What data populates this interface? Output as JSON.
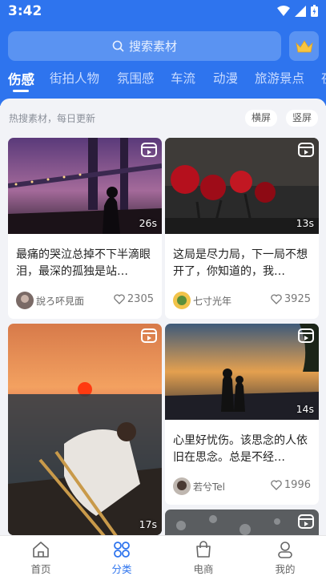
{
  "status_bar": {
    "time": "3:42",
    "icons": [
      "wifi-icon",
      "signal-icon",
      "battery-icon"
    ]
  },
  "search": {
    "placeholder": "搜索素材",
    "icon": "search-icon"
  },
  "vip": {
    "icon": "crown-icon"
  },
  "tabs": [
    {
      "label": "伤感",
      "active": true
    },
    {
      "label": "街拍人物"
    },
    {
      "label": "氛围感"
    },
    {
      "label": "车流"
    },
    {
      "label": "动漫"
    },
    {
      "label": "旅游景点"
    },
    {
      "label": "夜"
    }
  ],
  "panel": {
    "hint": "热搜素材，每日更新",
    "orient_horizontal": "横屏",
    "orient_vertical": "竖屏"
  },
  "cards": [
    {
      "duration": "26s",
      "title": "最痛的哭泣总掉不下半滴眼泪，最深的孤独是站…",
      "author": "說ろ吥見面",
      "likes": "2305"
    },
    {
      "duration": "13s",
      "title": "这局是尽力局，下一局不想开了，你知道的，我…",
      "author": "七寸光年",
      "likes": "3925"
    },
    {
      "duration": "17s"
    },
    {
      "duration": "14s",
      "title": "心里好忧伤。该思念的人依旧在思念。总是不经…",
      "author": "若兮Tel",
      "likes": "1996"
    },
    {}
  ],
  "nav": [
    {
      "label": "首页",
      "icon": "home-icon"
    },
    {
      "label": "分类",
      "icon": "category-icon",
      "active": true
    },
    {
      "label": "电商",
      "icon": "shopping-bag-icon"
    },
    {
      "label": "我的",
      "icon": "profile-icon"
    }
  ],
  "colors": {
    "brand": "#2e74ee",
    "panel_bg": "#f2f3f7"
  }
}
